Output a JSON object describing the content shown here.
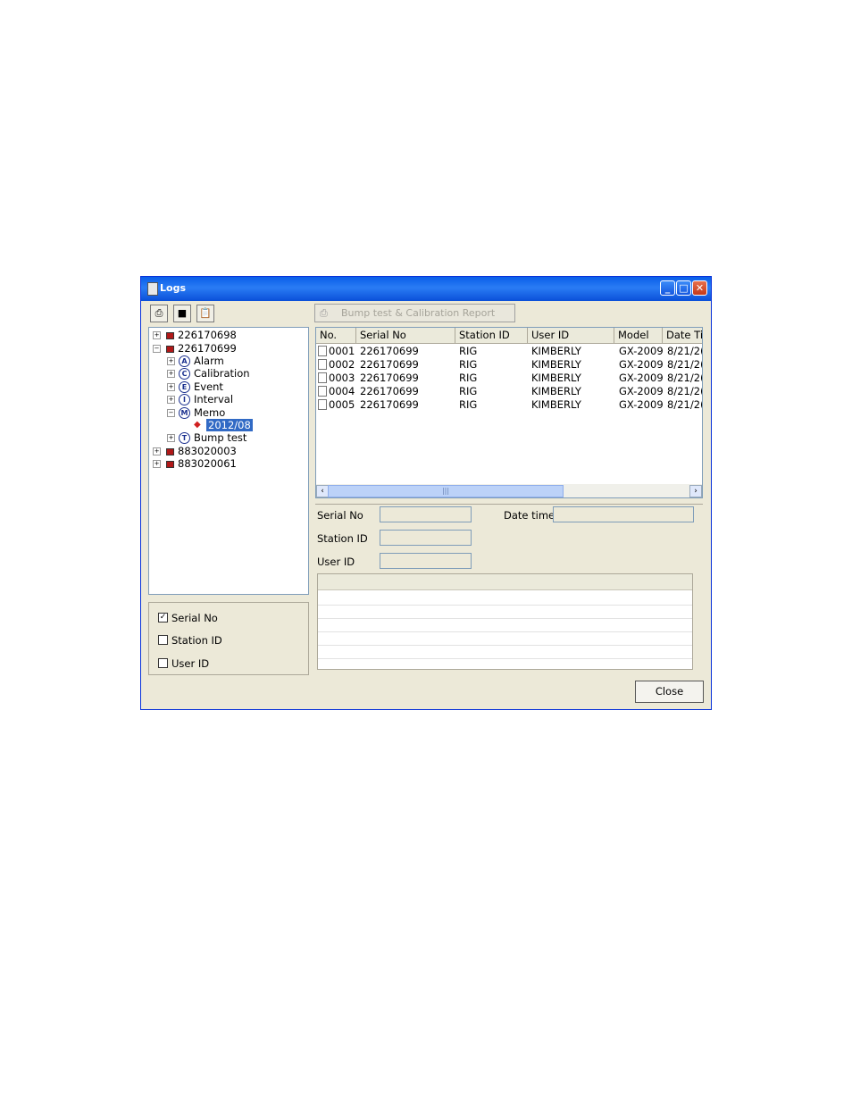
{
  "window": {
    "title": "Logs",
    "close_label": "Close"
  },
  "toolbar": {
    "print_icon": "printer-icon",
    "save_icon": "floppy-disk-icon",
    "clipboard_icon": "clipboard-icon",
    "report_button_label": "Bump test & Calibration Report"
  },
  "tree": {
    "device1": "226170698",
    "device2": "226170699",
    "alarm": "Alarm",
    "calibration": "Calibration",
    "event": "Event",
    "interval": "Interval",
    "memo": "Memo",
    "memo_child": "2012/08",
    "bump": "Bump test",
    "device3": "883020003",
    "device4": "883020061",
    "glyph_a": "A",
    "glyph_c": "C",
    "glyph_e": "E",
    "glyph_i": "I",
    "glyph_m": "M",
    "glyph_t": "T"
  },
  "filters": {
    "serial_no": "Serial No",
    "station_id": "Station ID",
    "user_id": "User ID",
    "serial_checked": true,
    "station_checked": false,
    "user_checked": false
  },
  "table": {
    "headers": {
      "no": "No.",
      "serial": "Serial No",
      "station": "Station ID",
      "user": "User ID",
      "model": "Model",
      "date": "Date Ti"
    },
    "rows": [
      {
        "no": "0001",
        "serial": "226170699",
        "station": "RIG",
        "user": "KIMBERLY",
        "model": "GX-2009",
        "date": "8/21/2("
      },
      {
        "no": "0002",
        "serial": "226170699",
        "station": "RIG",
        "user": "KIMBERLY",
        "model": "GX-2009",
        "date": "8/21/2("
      },
      {
        "no": "0003",
        "serial": "226170699",
        "station": "RIG",
        "user": "KIMBERLY",
        "model": "GX-2009",
        "date": "8/21/2("
      },
      {
        "no": "0004",
        "serial": "226170699",
        "station": "RIG",
        "user": "KIMBERLY",
        "model": "GX-2009",
        "date": "8/21/2("
      },
      {
        "no": "0005",
        "serial": "226170699",
        "station": "RIG",
        "user": "KIMBERLY",
        "model": "GX-2009",
        "date": "8/21/2("
      }
    ]
  },
  "detail": {
    "serial_label": "Serial No",
    "date_label": "Date time",
    "station_label": "Station ID",
    "user_label": "User ID"
  }
}
